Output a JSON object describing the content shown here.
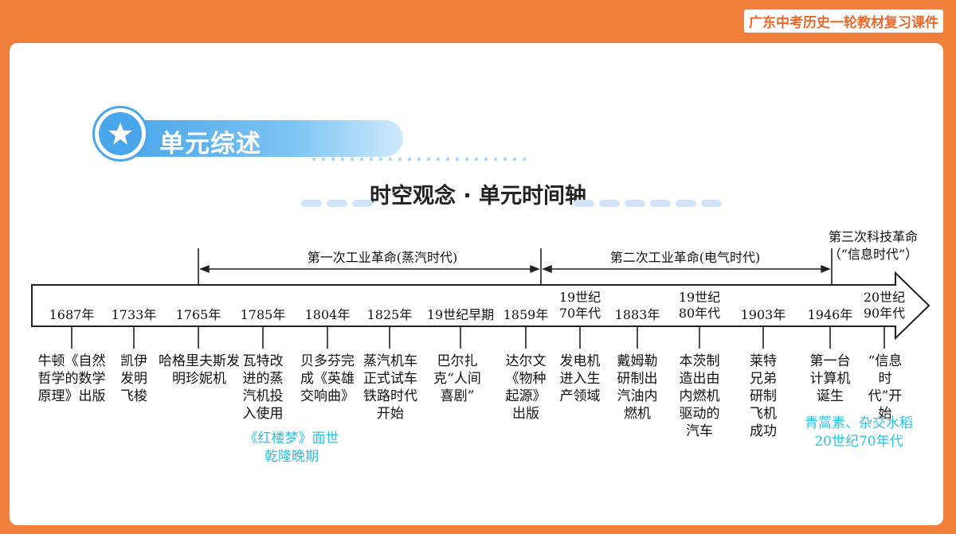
{
  "header": {
    "course_label": "广东中考历史一轮教材复习课件"
  },
  "section": {
    "badge_title": "单元综述",
    "subtitle": "时空观念 · 单元时间轴"
  },
  "eras": [
    {
      "label": "第一次工业革命(蒸汽时代)"
    },
    {
      "label": "第二次工业革命(电气时代)"
    },
    {
      "label_line1": "第三次科技革命",
      "label_line2": "（“信息时代”）"
    }
  ],
  "years": [
    "1687年",
    "1733年",
    "1765年",
    "1785年",
    "1804年",
    "1825年",
    "19世纪早期",
    "1859年",
    "19世纪70年代",
    "1883年",
    "19世纪80年代",
    "1903年",
    "1946年",
    "20世纪90年代"
  ],
  "events": [
    "牛顿《自然哲学的数学原理》出版",
    "凯伊发明飞梭",
    "哈格里夫斯发明珍妮机",
    "瓦特改进的蒸汽机投入使用",
    "贝多芬完成《英雄交响曲》",
    "蒸汽机车正式试车铁路时代开始",
    "巴尔扎克“人间喜剧”",
    "达尔文《物种起源》出版",
    "发电机进入生产领域",
    "戴姆勒研制出汽油内燃机",
    "本茨制造出由内燃机驱动的汽车",
    "莱特兄弟研制飞机成功",
    "第一台计算机诞生",
    "“信息时代”开始"
  ],
  "cn_notes": [
    {
      "line1": "《红楼梦》面世",
      "line2": "乾隆晚期"
    },
    {
      "line1": "青蒿素、杂交水稻",
      "line2": "20世纪70年代"
    }
  ],
  "colors": {
    "frame": "#f07f3c",
    "accent_blue": "#4aa6ea",
    "note_cyan": "#27c3e3"
  }
}
